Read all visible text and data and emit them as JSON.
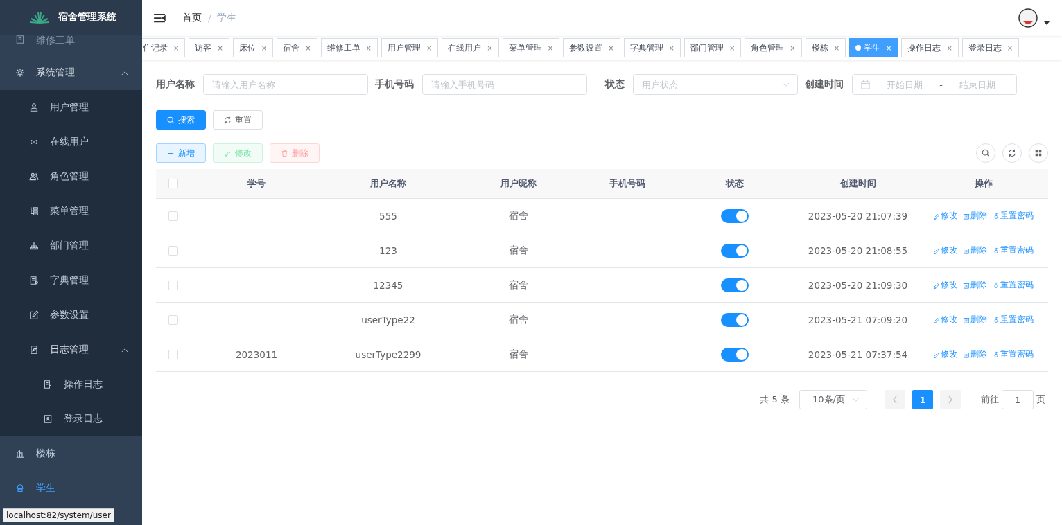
{
  "sidebar": {
    "title": "宿舍管理系统",
    "items": [
      {
        "label": "维修工单",
        "kind": "item",
        "selected": false
      },
      {
        "label": "系统管理",
        "kind": "group",
        "expanded": true,
        "selected": false,
        "children": [
          {
            "label": "用户管理",
            "kind": "item"
          },
          {
            "label": "在线用户",
            "kind": "item"
          },
          {
            "label": "角色管理",
            "kind": "item"
          },
          {
            "label": "菜单管理",
            "kind": "item"
          },
          {
            "label": "部门管理",
            "kind": "item"
          },
          {
            "label": "字典管理",
            "kind": "item"
          },
          {
            "label": "参数设置",
            "kind": "item"
          },
          {
            "label": "日志管理",
            "kind": "group",
            "expanded": true,
            "children": [
              {
                "label": "操作日志"
              },
              {
                "label": "登录日志"
              }
            ]
          }
        ]
      },
      {
        "label": "楼栋",
        "kind": "item",
        "selected": false
      },
      {
        "label": "学生",
        "kind": "item",
        "selected": true
      }
    ]
  },
  "breadcrumb": [
    "首页",
    "学生"
  ],
  "breadcrumb_separator": "/",
  "tags": [
    {
      "label": "住记录",
      "selected": false
    },
    {
      "label": "访客",
      "selected": false
    },
    {
      "label": "床位",
      "selected": false
    },
    {
      "label": "宿舍",
      "selected": false
    },
    {
      "label": "维修工单",
      "selected": false
    },
    {
      "label": "用户管理",
      "selected": false
    },
    {
      "label": "在线用户",
      "selected": false
    },
    {
      "label": "菜单管理",
      "selected": false
    },
    {
      "label": "参数设置",
      "selected": false
    },
    {
      "label": "字典管理",
      "selected": false
    },
    {
      "label": "部门管理",
      "selected": false
    },
    {
      "label": "角色管理",
      "selected": false
    },
    {
      "label": "楼栋",
      "selected": false
    },
    {
      "label": "学生",
      "selected": true
    },
    {
      "label": "操作日志",
      "selected": false
    },
    {
      "label": "登录日志",
      "selected": false
    }
  ],
  "tag_close": "×",
  "filters": [
    {
      "label": "用户名称",
      "kind": "input",
      "placeholder": "请输入用户名称"
    },
    {
      "label": "手机号码",
      "kind": "input",
      "placeholder": "请输入手机号码"
    },
    {
      "label": "状态",
      "kind": "select",
      "placeholder": "用户状态"
    },
    {
      "label": "创建时间",
      "kind": "daterange",
      "placeholder": "开始日期",
      "placeholder_end": "结束日期",
      "separator": "-"
    }
  ],
  "search_buttons": [
    {
      "label": "搜索",
      "kind": "primary"
    },
    {
      "label": "重置",
      "kind": "plain"
    }
  ],
  "toolbar": [
    {
      "label": "新增",
      "kind": "add",
      "disabled": false
    },
    {
      "label": "修改",
      "kind": "edit",
      "disabled": true
    },
    {
      "label": "删除",
      "kind": "delete",
      "disabled": true
    }
  ],
  "table": {
    "all_checked": false,
    "columns": [
      "学号",
      "用户名称",
      "用户昵称",
      "手机号码",
      "状态",
      "创建时间",
      "操作"
    ],
    "rows": [
      {
        "checked": false,
        "username": "555",
        "nickname": "宿舍",
        "on": true,
        "created": "2023-05-20 21:07:39",
        "actions": [
          "修改",
          "删除",
          "重置密码"
        ]
      },
      {
        "checked": false,
        "username": "123",
        "nickname": "宿舍",
        "on": true,
        "created": "2023-05-20 21:08:55",
        "actions": [
          "修改",
          "删除",
          "重置密码"
        ]
      },
      {
        "checked": false,
        "username": "12345",
        "nickname": "宿舍",
        "on": true,
        "created": "2023-05-20 21:09:30",
        "actions": [
          "修改",
          "删除",
          "重置密码"
        ]
      },
      {
        "checked": false,
        "username": "userType22",
        "nickname": "宿舍",
        "on": true,
        "created": "2023-05-21 07:09:20",
        "actions": [
          "修改",
          "删除",
          "重置密码"
        ]
      },
      {
        "checked": false,
        "student_id": "2023011",
        "username": "userType2299",
        "nickname": "宿舍",
        "on": true,
        "created": "2023-05-21 07:37:54",
        "actions": [
          "修改",
          "删除",
          "重置密码"
        ]
      }
    ]
  },
  "pagination": {
    "total": "共 5 条",
    "page_size": "10条/页",
    "pages": [
      {
        "label": "1",
        "selected": true
      }
    ],
    "goto_label": "前往",
    "goto_value": "1",
    "goto_suffix": "页"
  },
  "status_url": "localhost:82/system/user"
}
